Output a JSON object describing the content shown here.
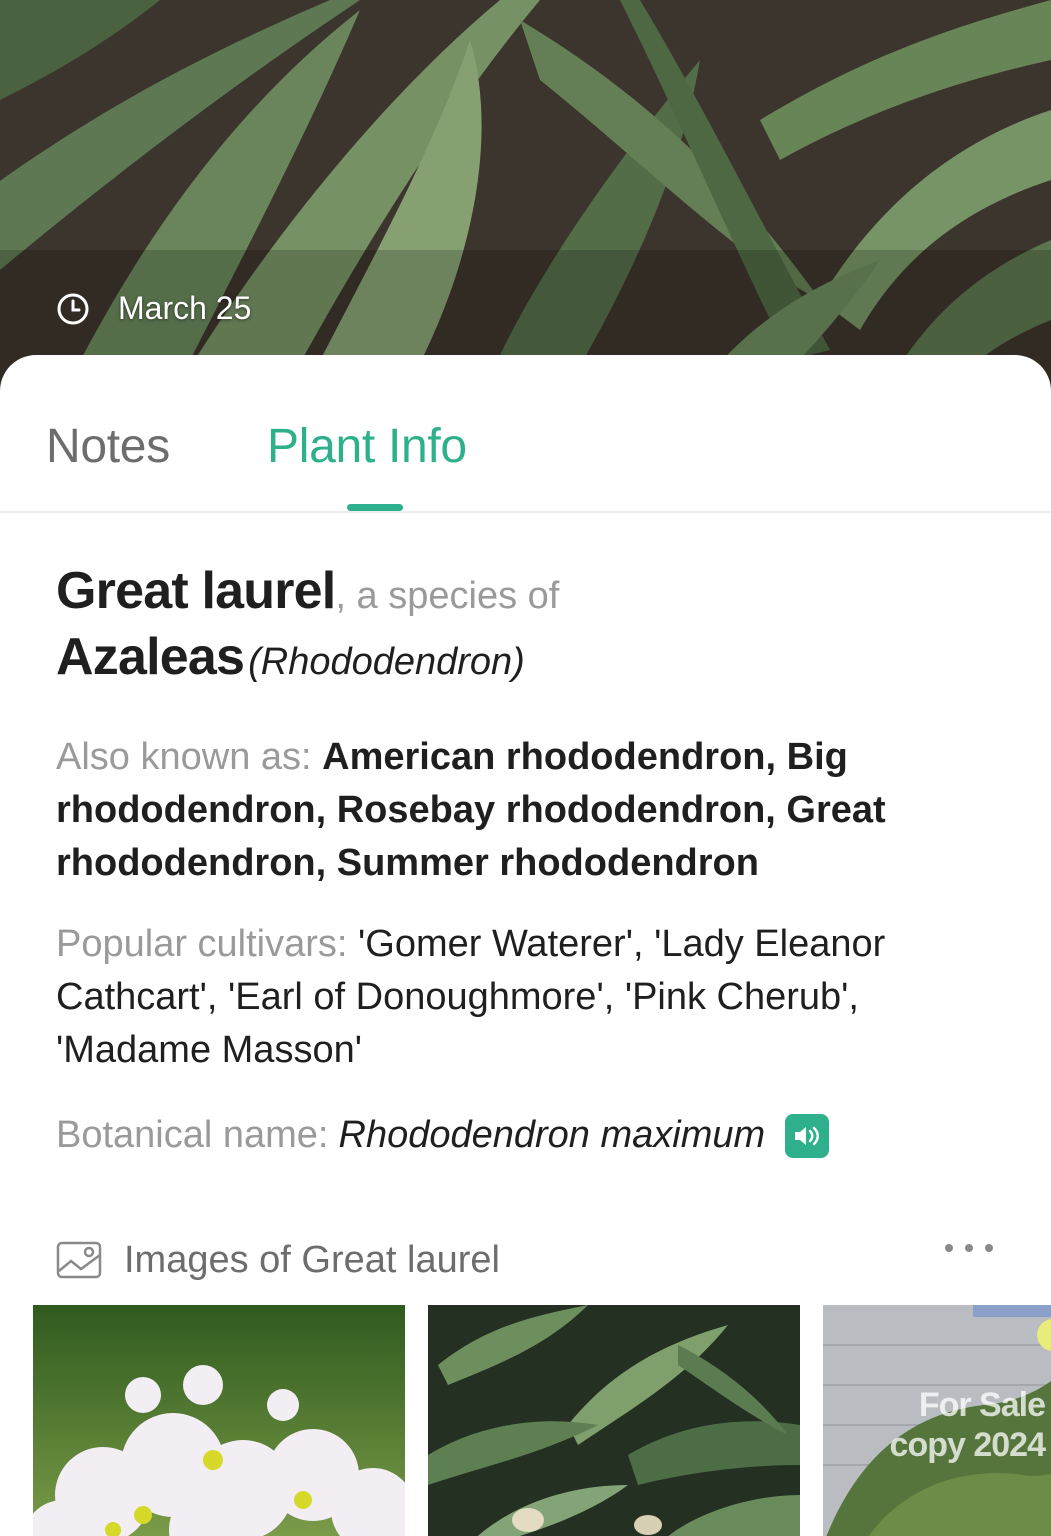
{
  "hero": {
    "date": "March 25",
    "date_icon": "clock-icon"
  },
  "tabs": [
    {
      "label": "Notes",
      "active": false
    },
    {
      "label": "Plant Info",
      "active": true
    }
  ],
  "plant": {
    "common_name": "Great laurel",
    "species_connector": ", a species of",
    "genus": "Azaleas",
    "genus_scientific": "(Rhododendron)",
    "aka_label": "Also known as:",
    "aka_value": "American rhododendron, Big rhododendron, Rosebay rhododendron, Great rhododendron, Summer rhododendron",
    "cultivars_label": "Popular cultivars:",
    "cultivars_value": "'Gomer Waterer', 'Lady Eleanor Cathcart', 'Earl of Donoughmore', 'Pink Cherub', 'Madame Masson'",
    "botanical_label": "Botanical name:",
    "botanical_value": "Rhododendron maximum",
    "speaker_icon": "speaker-icon"
  },
  "images": {
    "title": "Images of Great laurel",
    "icon": "image-gallery-icon",
    "more_icon": "more-horizontal-icon",
    "watermark_line1": "For Sale",
    "watermark_line2": "copy 2024"
  },
  "colors": {
    "accent": "#2fb08d",
    "text_primary": "#1f1f1f",
    "text_secondary": "#9a9a9a",
    "tab_inactive": "#6d6d6d"
  }
}
